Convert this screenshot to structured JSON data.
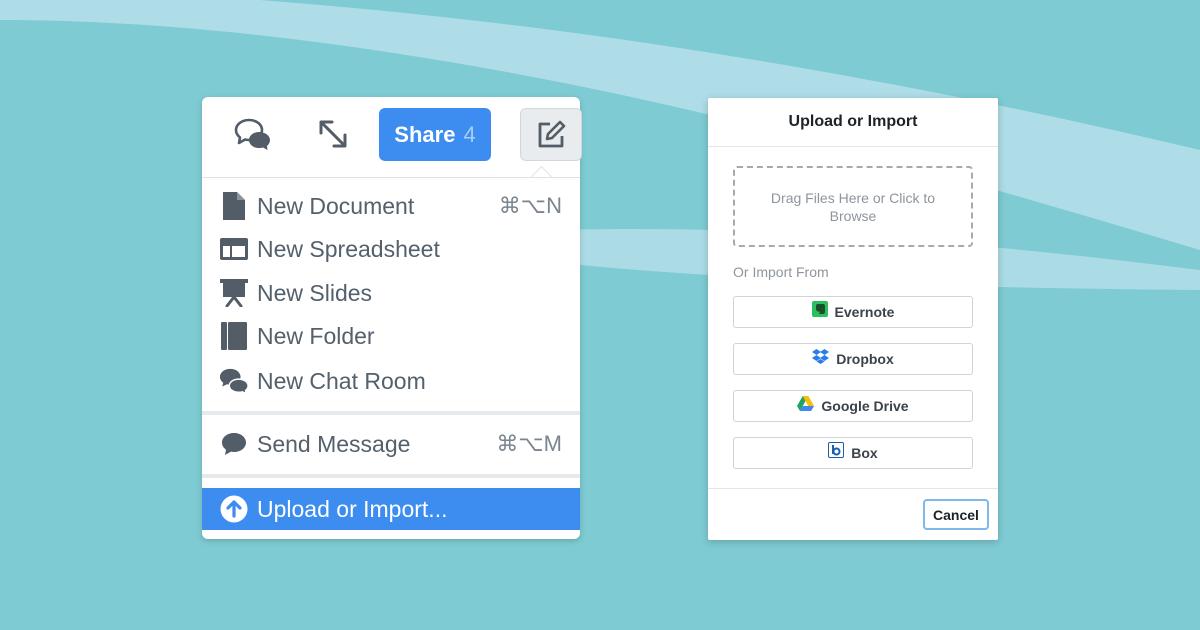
{
  "toolbar": {
    "share_label": "Share",
    "share_count": "4",
    "icons": [
      "chat-bubbles-icon",
      "expand-icon",
      "compose-icon"
    ]
  },
  "menu": {
    "items": [
      {
        "label": "New Document",
        "shortcut": "⌘⌥N",
        "icon": "document-icon"
      },
      {
        "label": "New Spreadsheet",
        "shortcut": "",
        "icon": "spreadsheet-icon"
      },
      {
        "label": "New Slides",
        "shortcut": "",
        "icon": "slides-icon"
      },
      {
        "label": "New Folder",
        "shortcut": "",
        "icon": "folder-icon"
      },
      {
        "label": "New Chat Room",
        "shortcut": "",
        "icon": "chat-room-icon"
      },
      {
        "label": "Send Message",
        "shortcut": "⌘⌥M",
        "icon": "message-icon"
      },
      {
        "label": "Upload or Import...",
        "shortcut": "",
        "icon": "upload-icon",
        "active": true
      }
    ]
  },
  "dialog": {
    "title": "Upload or Import",
    "dropzone_text": "Drag Files Here or Click to Browse",
    "import_from_label": "Or Import From",
    "services": [
      {
        "label": "Evernote",
        "icon": "evernote-icon"
      },
      {
        "label": "Dropbox",
        "icon": "dropbox-icon"
      },
      {
        "label": "Google Drive",
        "icon": "google-drive-icon"
      },
      {
        "label": "Box",
        "icon": "box-icon"
      }
    ],
    "cancel_label": "Cancel"
  },
  "colors": {
    "background": "#7ecbd3",
    "accent": "#3d8cf0",
    "menu_text": "#54606c"
  }
}
